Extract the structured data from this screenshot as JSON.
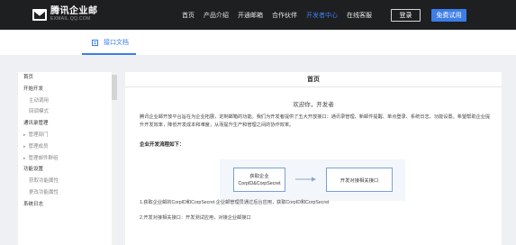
{
  "header": {
    "logo": {
      "name": "腾讯企业邮",
      "domain": "EXMAIL.QQ.COM"
    },
    "nav": [
      "首页",
      "产品介绍",
      "开通邮箱",
      "合作伙伴",
      "开发者中心",
      "在线客服"
    ],
    "active_nav": "开发者中心",
    "login_label": "登录",
    "trial_label": "免费试用"
  },
  "subheader": {
    "tab_label": "接口文档",
    "tab_icon": "document-icon"
  },
  "sidebar": {
    "items": [
      {
        "label": "首页",
        "kind": "top"
      },
      {
        "label": "开始开发",
        "kind": "top"
      },
      {
        "label": "主动调用",
        "kind": "sub"
      },
      {
        "label": "回调模式",
        "kind": "sub"
      },
      {
        "label": "通讯录管理",
        "kind": "top"
      },
      {
        "label": "管理部门",
        "kind": "expand"
      },
      {
        "label": "管理成员",
        "kind": "expand"
      },
      {
        "label": "管理邮件群组",
        "kind": "expand"
      },
      {
        "label": "功能设置",
        "kind": "top"
      },
      {
        "label": "获取功能属性",
        "kind": "sub"
      },
      {
        "label": "更改功能属性",
        "kind": "sub"
      },
      {
        "label": "系统日志",
        "kind": "top"
      }
    ]
  },
  "main": {
    "title": "首页",
    "welcome": "欢迎你，开发者",
    "intro": "腾讯企业邮开放平台旨在为企业拓展，定制邮箱的功能。我们为开发者提供了五大开放接口：通讯录管理、新邮件提醒、单点登录、系统日志、功能设置。希望帮助企业提升开发效率，降低开发成本和难度，从而提升生产和管理之间的协作效率。",
    "flow_heading": "企业开发流程如下：",
    "flow": {
      "step1_line1": "获取企业",
      "step1_line2": "CorpID&CorpSecret",
      "step2": "开发对接相关接口"
    },
    "note1": "1.获取企业邮的CorpID和CorpSecret  企业邮管理员通过后台应用，获取CorpID和CorpSecret",
    "note2": "2.开发对接相关接口：开发测试应用，对接企业邮接口"
  },
  "colors": {
    "accent": "#3d7de8",
    "topbar": "#1e1f21",
    "page_bg": "#eef0f3"
  }
}
